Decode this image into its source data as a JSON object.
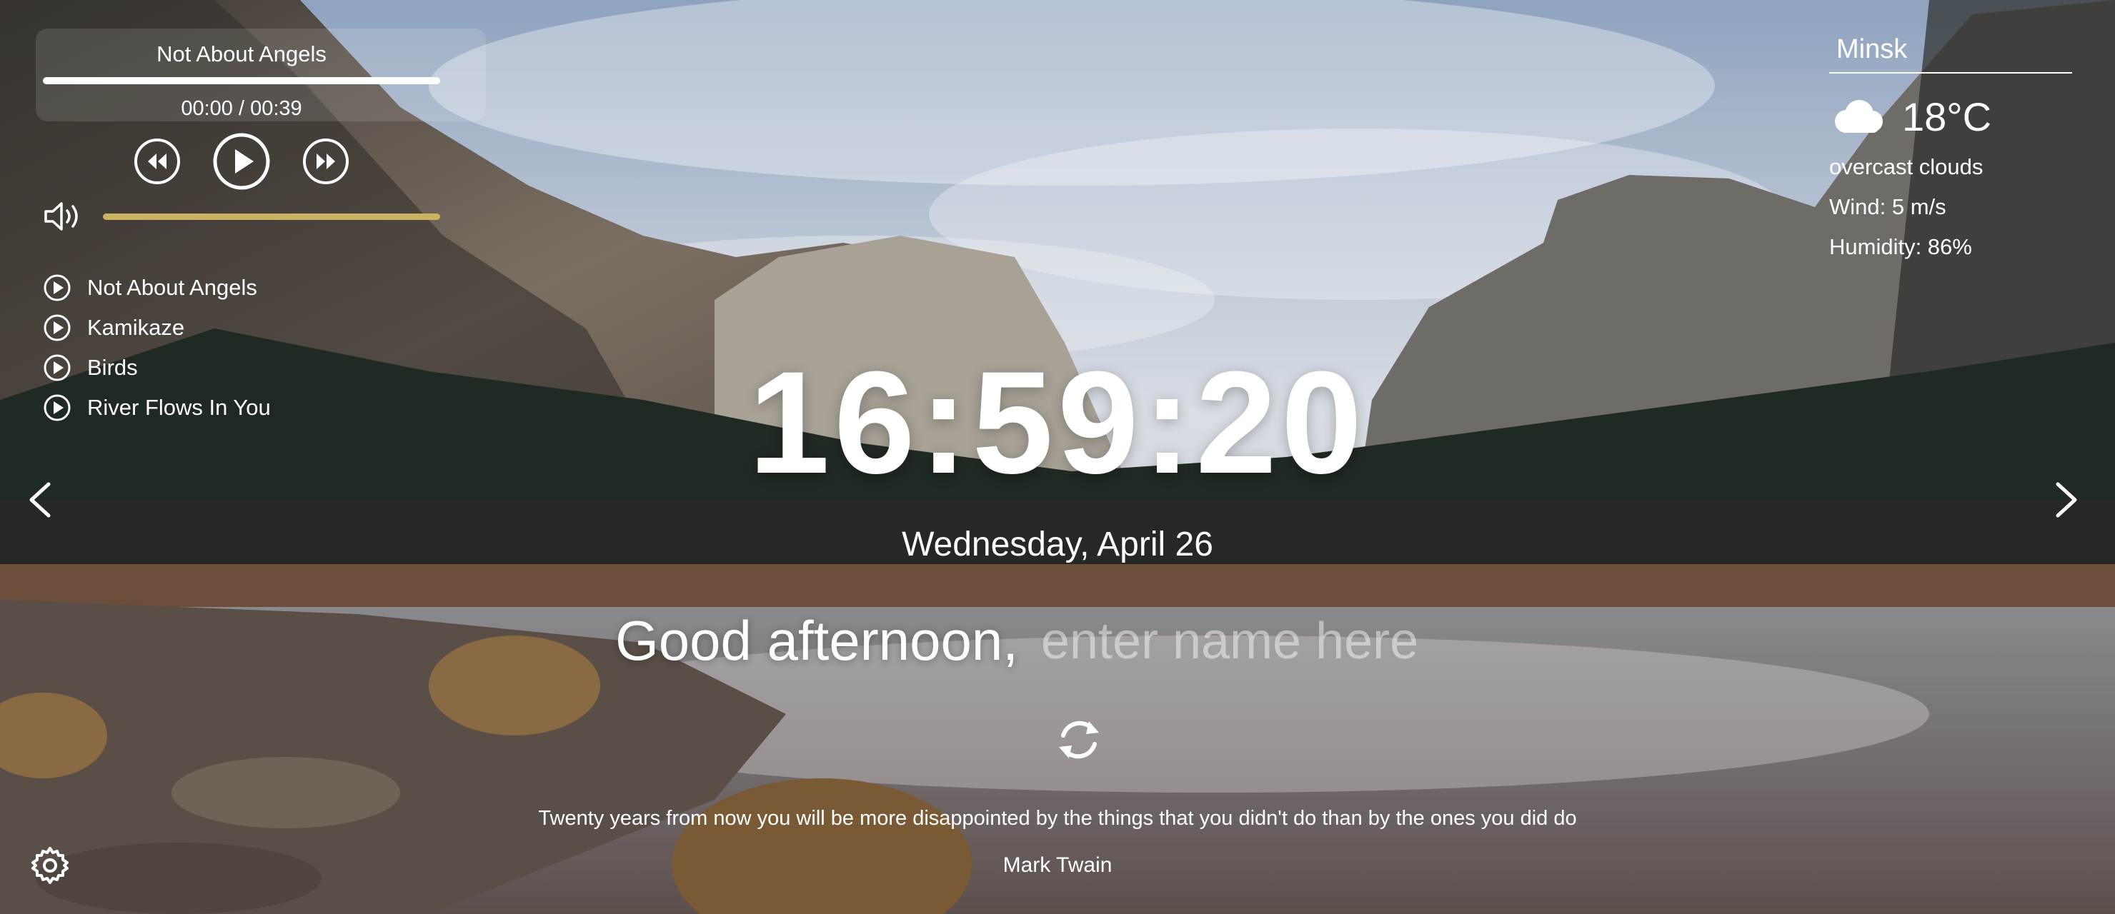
{
  "player": {
    "current_track": "Not About Angels",
    "time": "00:00 / 00:39",
    "progress": 0.0,
    "volume": 1.0,
    "icons": {
      "prev": "rewind-icon",
      "play": "play-icon",
      "next": "fast-forward-icon",
      "volume": "volume-icon"
    },
    "playlist": [
      {
        "title": "Not About Angels"
      },
      {
        "title": "Kamikaze"
      },
      {
        "title": "Birds"
      },
      {
        "title": "River Flows In You"
      }
    ]
  },
  "weather": {
    "city": "Minsk",
    "icon": "cloud-icon",
    "temperature": "18°C",
    "description": "overcast clouds",
    "wind": "Wind: 5 m/s",
    "humidity": "Humidity: 86%"
  },
  "time": "16:59:20",
  "date": "Wednesday, April 26",
  "greeting": "Good afternoon,",
  "name_placeholder": "enter name here",
  "quote": {
    "text": "Twenty years from now you will be more disappointed by the things that you didn't do than by the ones you did do",
    "author": "Mark Twain"
  },
  "colors": {
    "volume_bar": "#c9b261",
    "text": "#ffffff"
  }
}
